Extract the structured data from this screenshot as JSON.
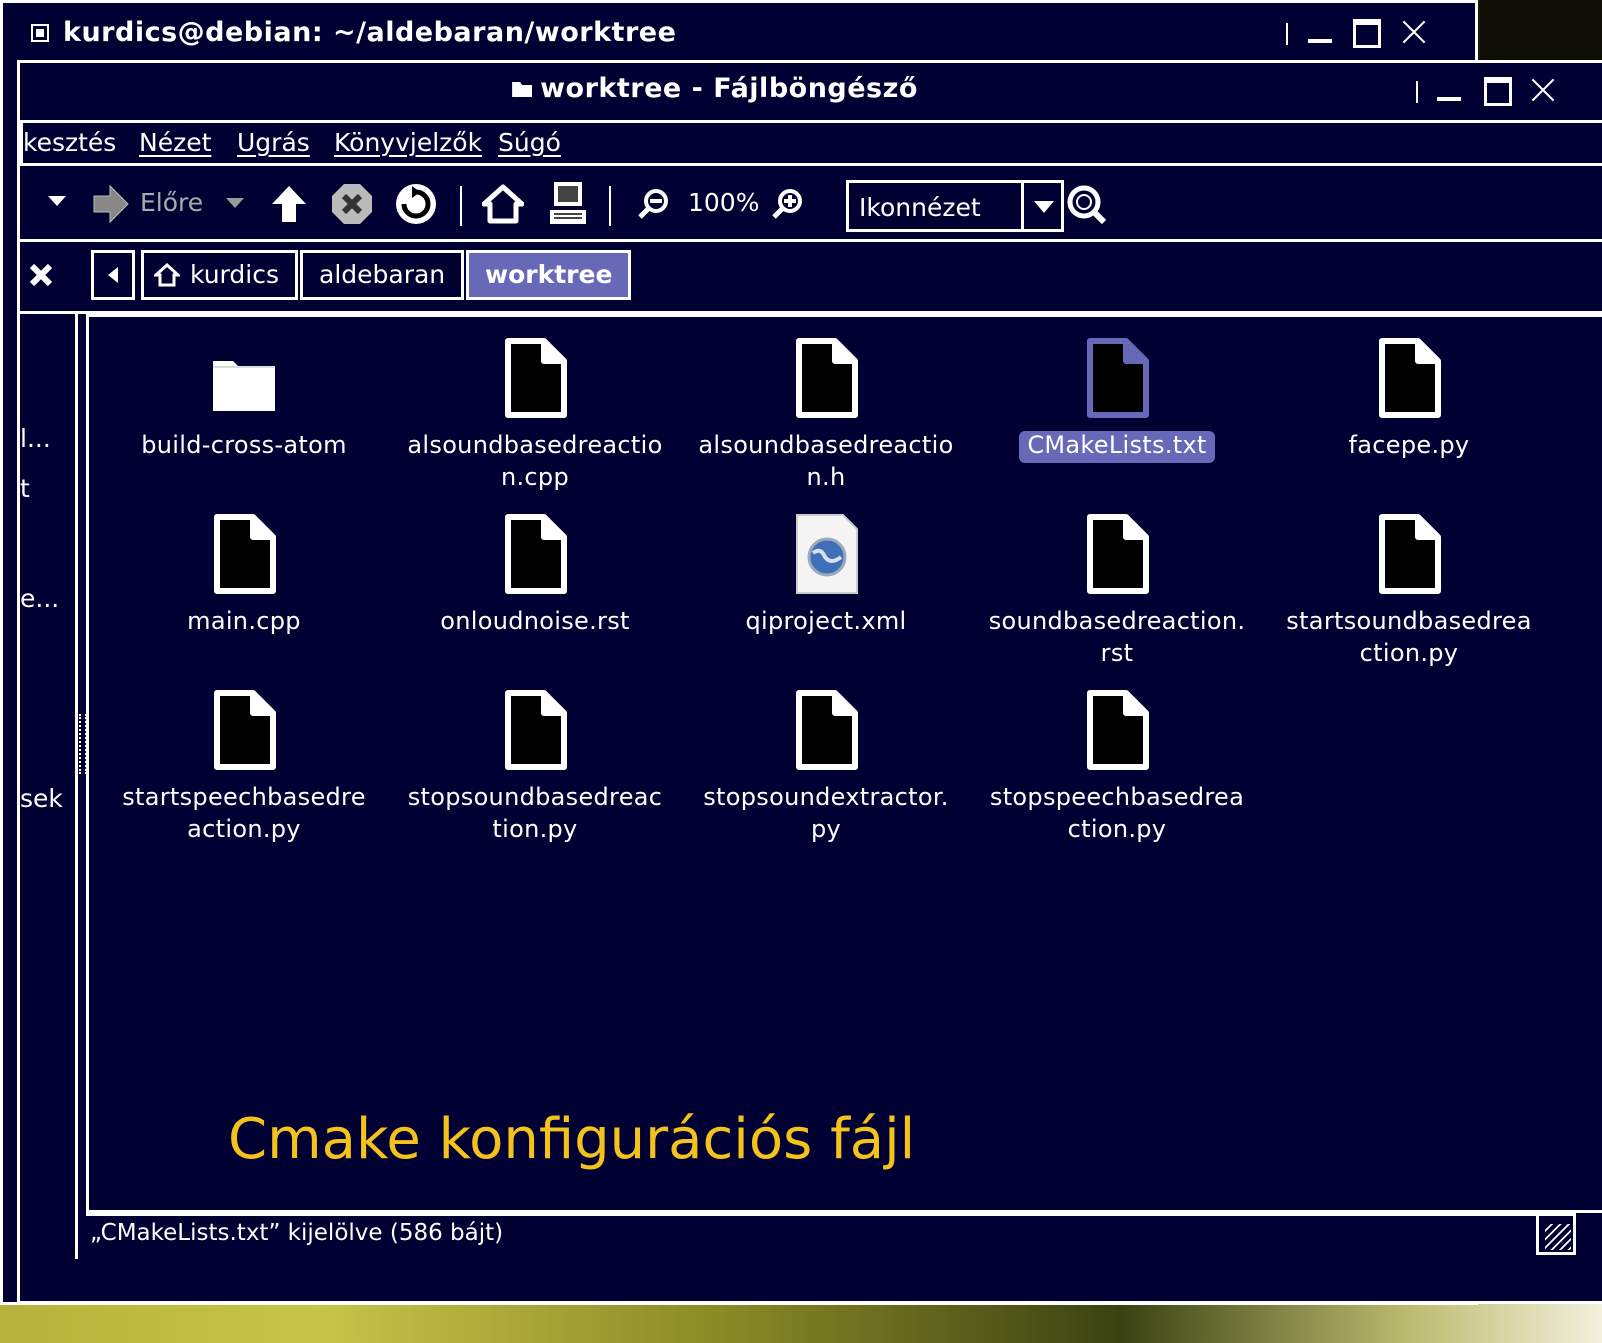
{
  "terminal": {
    "title": "kurdics@debian: ~/aldebaran/worktree"
  },
  "window": {
    "title": "worktree - Fájlböngésző"
  },
  "menu": [
    "kesztés",
    "Nézet",
    "Ugrás",
    "Könyvjelzők",
    "Súgó"
  ],
  "toolbar": {
    "forward_label": "Előre",
    "zoom_level": "100%",
    "view_mode": "Ikonnézet"
  },
  "breadcrumbs": [
    "kurdics",
    "aldebaran",
    "worktree"
  ],
  "sidepane": [
    "l...",
    "t",
    "e...",
    "sek"
  ],
  "files": [
    {
      "name": "build-cross-atom",
      "icon": "folder-icon"
    },
    {
      "name": "alsoundbasedreactio\nn.cpp",
      "icon": "file-icon"
    },
    {
      "name": "alsoundbasedreactio\nn.h",
      "icon": "file-icon"
    },
    {
      "name": "CMakeLists.txt",
      "icon": "file-icon",
      "selected": true
    },
    {
      "name": "facepe.py",
      "icon": "file-icon"
    },
    {
      "name": "main.cpp",
      "icon": "file-icon"
    },
    {
      "name": "onloudnoise.rst",
      "icon": "file-icon"
    },
    {
      "name": "qiproject.xml",
      "icon": "xml-file-icon"
    },
    {
      "name": "soundbasedreaction.\nrst",
      "icon": "file-icon"
    },
    {
      "name": "startsoundbasedrea\nction.py",
      "icon": "file-icon"
    },
    {
      "name": "startspeechbasedre\naction.py",
      "icon": "file-icon"
    },
    {
      "name": "stopsoundbasedreac\ntion.py",
      "icon": "file-icon"
    },
    {
      "name": "stopsoundextractor.\npy",
      "icon": "file-icon"
    },
    {
      "name": "stopspeechbasedrea\nction.py",
      "icon": "file-icon"
    }
  ],
  "caption": "Cmake konfigurációs fájl",
  "status": "„CMakeLists.txt” kijelölve (586 bájt)",
  "colors": {
    "background": "#000033",
    "selection": "#6868b8",
    "caption": "#f4c21c",
    "foreground": "#ffffff"
  }
}
